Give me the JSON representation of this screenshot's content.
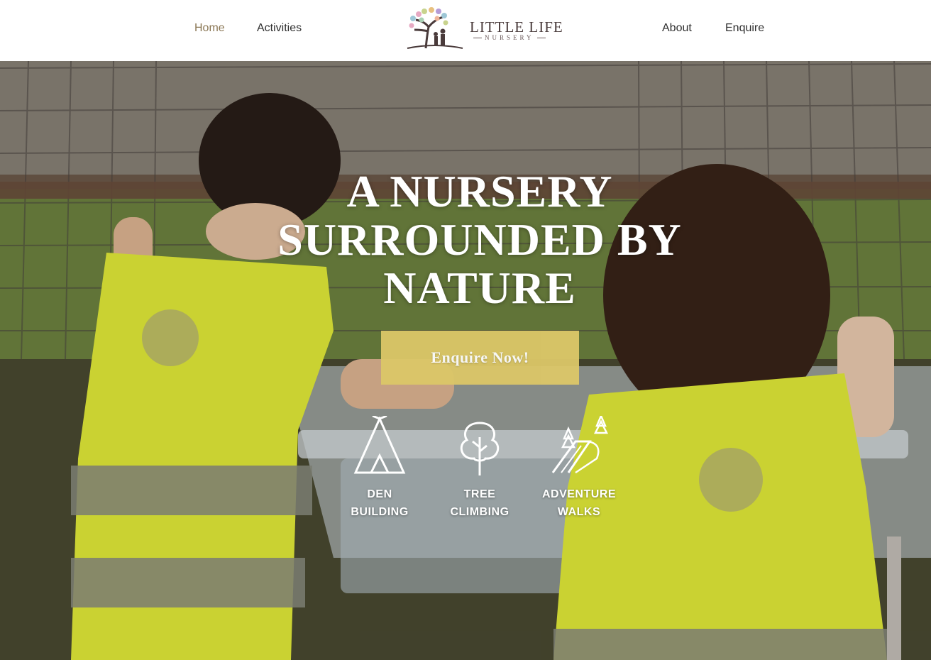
{
  "nav": {
    "home": "Home",
    "activities": "Activities",
    "about": "About",
    "enquire": "Enquire"
  },
  "logo": {
    "name": "LITTLE LIFE",
    "sub": "NURSERY",
    "icon": "tree-family-logo-icon"
  },
  "hero": {
    "title_lines": [
      "A NURSERY",
      "SURROUNDED BY",
      "NATURE"
    ],
    "cta_label": "Enquire Now!",
    "cta_color": "#dcc768",
    "features": [
      {
        "icon": "tepee-icon",
        "lines": [
          "DEN",
          "BUILDING"
        ]
      },
      {
        "icon": "tree-icon",
        "lines": [
          "TREE",
          "CLIMBING"
        ]
      },
      {
        "icon": "path-pines-icon",
        "lines": [
          "ADVENTURE",
          "WALKS"
        ]
      }
    ]
  },
  "colors": {
    "active_nav": "#8b7755",
    "nav_text": "#2f2f2f"
  }
}
